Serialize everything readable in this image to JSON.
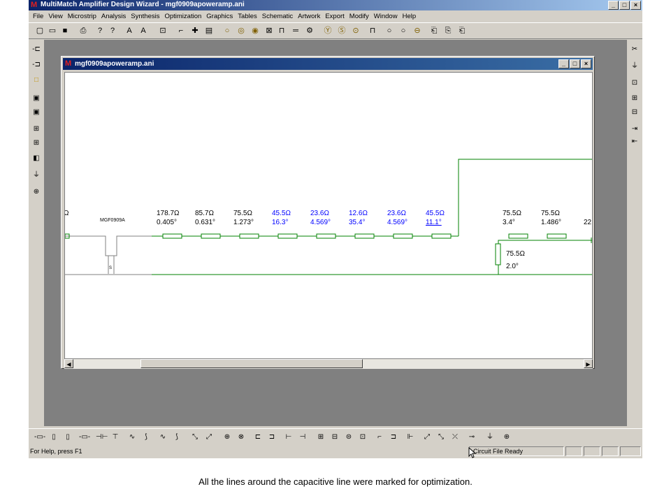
{
  "app": {
    "title": "MultiMatch Amplifier Design Wizard - mgf0909apoweramp.ani",
    "logo_glyph": "M",
    "buttons": [
      "_",
      "□",
      "×"
    ]
  },
  "menu": [
    "File",
    "View",
    "Microstrip",
    "Analysis",
    "Synthesis",
    "Optimization",
    "Graphics",
    "Tables",
    "Schematic",
    "Artwork",
    "Export",
    "Modify",
    "Window",
    "Help"
  ],
  "child_window": {
    "title": "mgf0909apoweramp.ani",
    "buttons": [
      "_",
      "□",
      "×"
    ]
  },
  "schematic": {
    "device_label": "MGF0909A",
    "source_label": "S",
    "left_cut_label": "Ω",
    "right_cut_label": "22.",
    "colors": {
      "wire": "#008000",
      "normal_text": "#000000",
      "optimized_text": "#0000ff",
      "device": "#808080"
    },
    "series_lines": [
      {
        "impedance": "178.7Ω",
        "angle": "0.405°",
        "optimized": false
      },
      {
        "impedance": "85.7Ω",
        "angle": "0.631°",
        "optimized": false
      },
      {
        "impedance": "75.5Ω",
        "angle": "1.273°",
        "optimized": false
      },
      {
        "impedance": "45.5Ω",
        "angle": "16.3°",
        "optimized": true
      },
      {
        "impedance": "23.6Ω",
        "angle": "4.569°",
        "optimized": true
      },
      {
        "impedance": "12.6Ω",
        "angle": "35.4°",
        "optimized": true
      },
      {
        "impedance": "23.6Ω",
        "angle": "4.569°",
        "optimized": true
      },
      {
        "impedance": "45.5Ω",
        "angle": "11.1°",
        "optimized": true
      },
      {
        "impedance": "75.5Ω",
        "angle": "3.4°",
        "optimized": false
      },
      {
        "impedance": "75.5Ω",
        "angle": "1.486°",
        "optimized": false
      }
    ],
    "shunt_line": {
      "impedance": "75.5Ω",
      "angle": "2.0°"
    }
  },
  "status": {
    "help": "For Help, press F1",
    "ready": "Circuit File Ready"
  },
  "caption": "All the lines around the capacitive line were marked for optimization."
}
